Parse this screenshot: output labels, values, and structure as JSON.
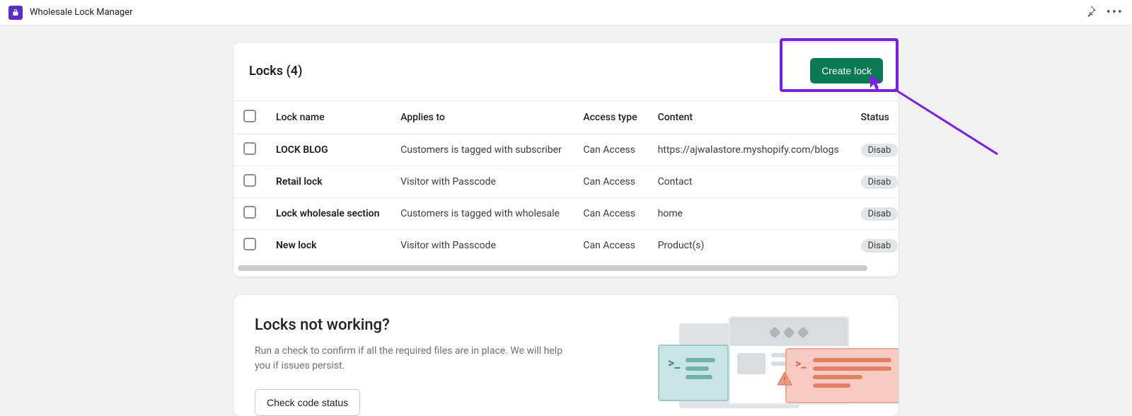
{
  "app": {
    "title": "Wholesale Lock Manager"
  },
  "locks_card": {
    "title": "Locks (4)",
    "create_label": "Create lock",
    "columns": {
      "name": "Lock name",
      "applies": "Applies to",
      "access": "Access type",
      "content": "Content",
      "status": "Status"
    },
    "rows": [
      {
        "name": "LOCK BLOG",
        "applies": "Customers is tagged with subscriber",
        "access": "Can Access",
        "content": "https://ajwalastore.myshopify.com/blogs",
        "status": "Disab"
      },
      {
        "name": "Retail lock",
        "applies": "Visitor with Passcode",
        "access": "Can Access",
        "content": "Contact",
        "status": "Disab"
      },
      {
        "name": "Lock wholesale section",
        "applies": "Customers is tagged with wholesale",
        "access": "Can Access",
        "content": "home",
        "status": "Disab"
      },
      {
        "name": "New lock",
        "applies": "Visitor with Passcode",
        "access": "Can Access",
        "content": "Product(s)",
        "status": "Disab"
      }
    ]
  },
  "help_card": {
    "title": "Locks not working?",
    "text": "Run a check to confirm if all the required files are in place. We will help you if issues persist.",
    "button": "Check code status"
  }
}
